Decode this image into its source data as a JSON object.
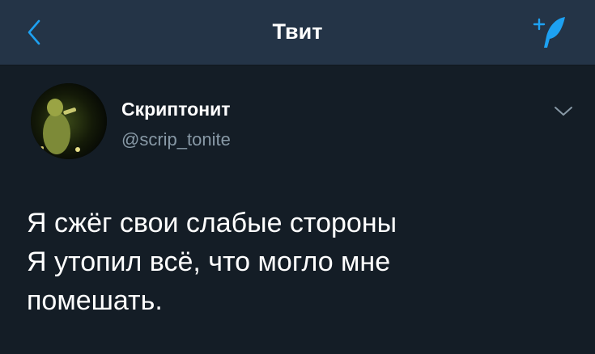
{
  "nav": {
    "back_icon": "chevron-left-icon",
    "title": "Твит",
    "compose_icon": "compose-feather-icon"
  },
  "tweet": {
    "author": {
      "display_name": "Скриптонит",
      "handle": "@scrip_tonite"
    },
    "caret_icon": "chevron-down-icon",
    "text_lines": [
      "Я сжёг свои слабые стороны",
      "Я утопил всё, что могло мне",
      "помешать."
    ]
  },
  "colors": {
    "background": "#141d26",
    "nav_background": "#243447",
    "accent": "#1da1f2",
    "text_primary": "#ffffff",
    "text_secondary": "#8899a6"
  }
}
